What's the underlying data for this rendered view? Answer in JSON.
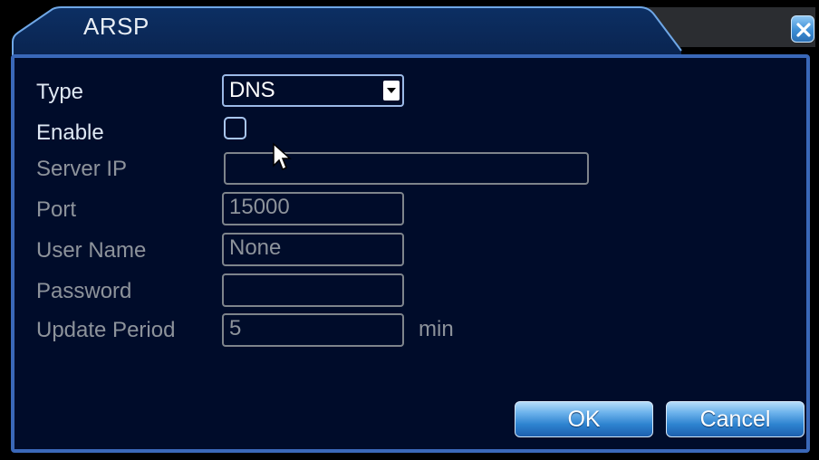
{
  "window": {
    "title": "ARSP",
    "close_icon": "close-x-icon"
  },
  "form": {
    "type": {
      "label": "Type",
      "value": "DNS"
    },
    "enable": {
      "label": "Enable",
      "checked": false
    },
    "server_ip": {
      "label": "Server IP",
      "value": ""
    },
    "port": {
      "label": "Port",
      "value": "15000"
    },
    "user_name": {
      "label": "User Name",
      "value": "None"
    },
    "password": {
      "label": "Password",
      "value": ""
    },
    "update_period": {
      "label": "Update Period",
      "value": "5",
      "unit": "min"
    }
  },
  "buttons": {
    "ok": "OK",
    "cancel": "Cancel"
  },
  "colors": {
    "panel_background": "#000c2a",
    "panel_border": "#3a68b8",
    "button_blue": "#2d83d0",
    "active_text": "#dfe8f3",
    "disabled_text": "#8d939b"
  }
}
